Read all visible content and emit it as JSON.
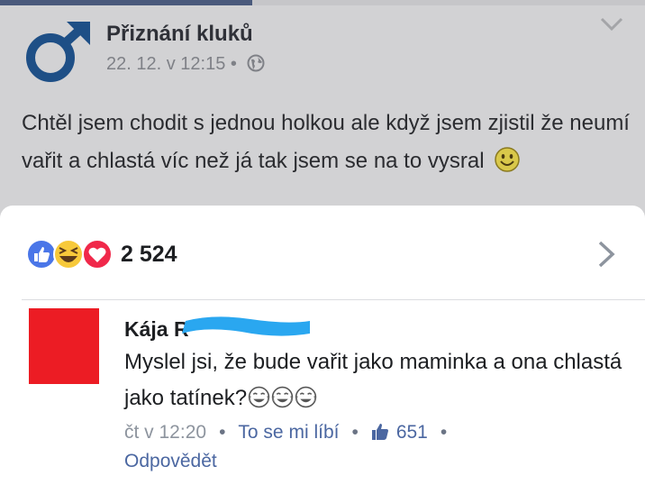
{
  "post": {
    "page_name": "Přiznání kluků",
    "timestamp": "22. 12. v 12:15",
    "separator": "•",
    "text": "Chtěl jsem chodit s jednou holkou ale když jsem zjistil že neumí vařit a chlastá víc než já tak jsem se na to vysral"
  },
  "reactions": {
    "icons": [
      "like-icon",
      "haha-icon",
      "love-icon"
    ],
    "count": "2 524"
  },
  "comment": {
    "author": "Kája R",
    "text": "Myslel jsi, že bude vařit jako maminka a ona chlastá jako tatínek?",
    "time": "čt v 12:20",
    "like_label": "To se mi líbí",
    "like_count": "651",
    "reply_label": "Odpovědět",
    "separator": "•"
  },
  "colors": {
    "background": "#d2d2d4",
    "sheet": "#ffffff",
    "link": "#4b67a1",
    "like_blue": "#4a76e8",
    "love_red": "#f0284a",
    "avatar": "#ec1c24",
    "redaction": "#2aa7f0"
  }
}
